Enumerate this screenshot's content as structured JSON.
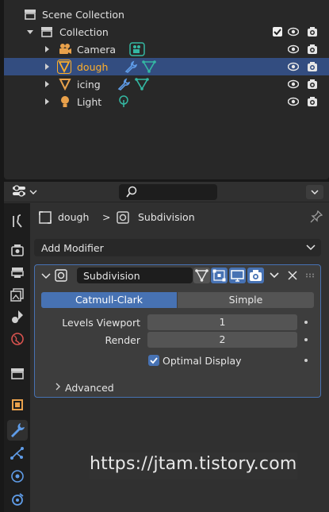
{
  "outliner": {
    "rows": [
      {
        "label": "Scene Collection"
      },
      {
        "label": "Collection"
      },
      {
        "label": "Camera"
      },
      {
        "label": "dough"
      },
      {
        "label": "icing"
      },
      {
        "label": "Light"
      }
    ]
  },
  "properties": {
    "breadcrumb": {
      "object": "dough",
      "separator": ">",
      "modifier": "Subdivision"
    },
    "add_modifier_label": "Add Modifier",
    "modifier": {
      "name": "Subdivision",
      "mode_options": [
        "Catmull-Clark",
        "Simple"
      ],
      "selected_mode": "Catmull-Clark",
      "levels_viewport_label": "Levels Viewport",
      "levels_viewport_value": "1",
      "render_label": "Render",
      "render_value": "2",
      "optimal_display_label": "Optimal Display",
      "optimal_display_checked": true,
      "advanced_label": "Advanced"
    }
  },
  "watermark": "https://jtam.tistory.com",
  "colors": {
    "accent": "#4772b3",
    "active_object": "#ffaf29",
    "selected_row": "#334d80",
    "mesh_data": "#34b8a3",
    "modifier_icon": "#5f9ce8"
  },
  "icons": [
    "collection-icon",
    "camera-icon",
    "mesh-icon",
    "light-icon",
    "eye-icon",
    "render-camera-icon",
    "wrench-icon",
    "search-icon",
    "pin-icon",
    "close-icon",
    "chevron-down-icon"
  ]
}
